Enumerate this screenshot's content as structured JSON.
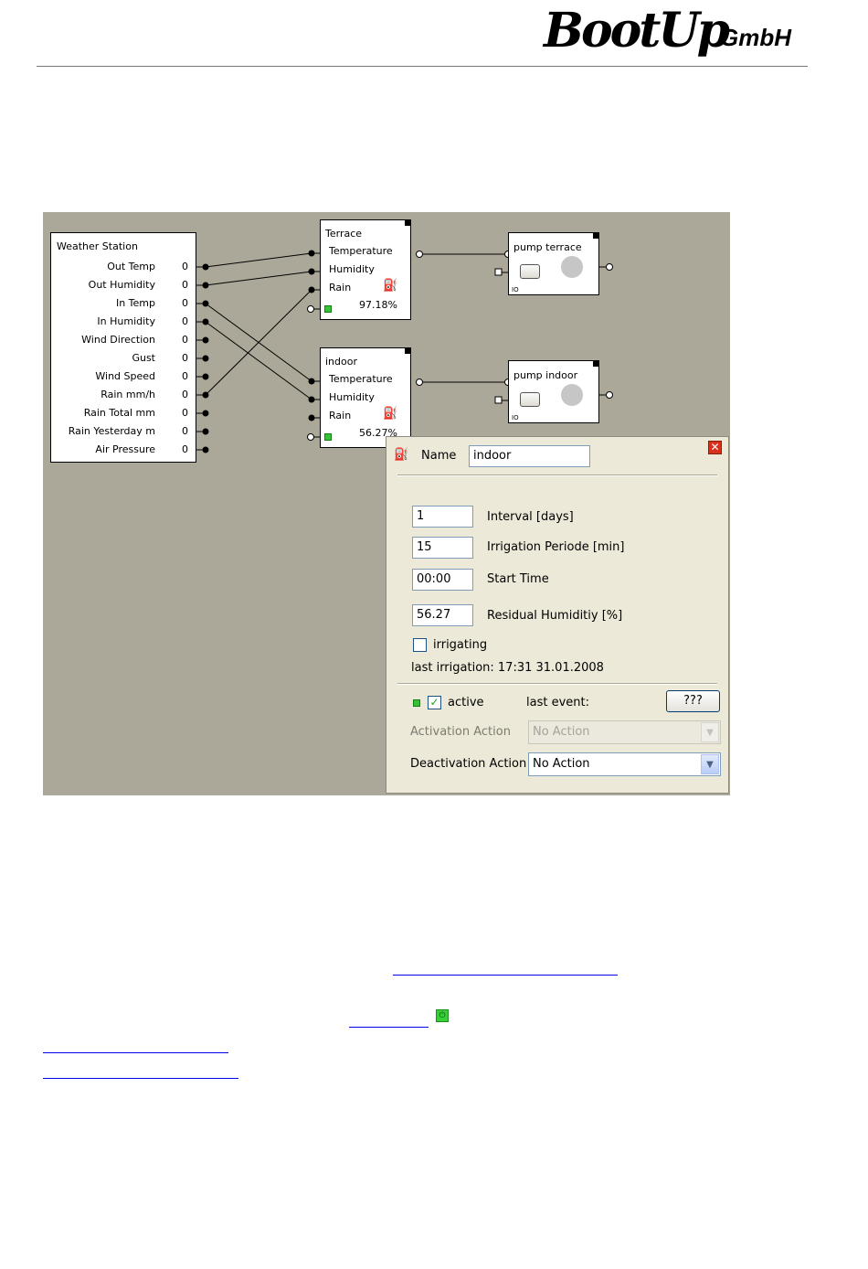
{
  "header": {
    "logo_main": "BootUp",
    "logo_suffix": "GmbH"
  },
  "weather_station": {
    "title": "Weather Station",
    "outputs": [
      {
        "label": "Out Temp",
        "value": "0"
      },
      {
        "label": "Out Humidity",
        "value": "0"
      },
      {
        "label": "In Temp",
        "value": "0"
      },
      {
        "label": "In Humidity",
        "value": "0"
      },
      {
        "label": "Wind Direction",
        "value": "0"
      },
      {
        "label": "Gust",
        "value": "0"
      },
      {
        "label": "Wind Speed",
        "value": "0"
      },
      {
        "label": "Rain mm/h",
        "value": "0"
      },
      {
        "label": "Rain Total mm",
        "value": "0"
      },
      {
        "label": "Rain Yesterday m",
        "value": "0"
      },
      {
        "label": "Air Pressure",
        "value": "0"
      }
    ]
  },
  "irrigation_blocks": [
    {
      "title": "Terrace",
      "inputs": [
        "Temperature",
        "Humidity",
        "Rain"
      ],
      "residual": "97.18%"
    },
    {
      "title": "indoor",
      "inputs": [
        "Temperature",
        "Humidity",
        "Rain"
      ],
      "residual": "56.27%"
    }
  ],
  "pumps": [
    {
      "title": "pump terrace",
      "io": "IO"
    },
    {
      "title": "pump indoor",
      "io": "IO"
    }
  ],
  "dialog": {
    "name_label": "Name",
    "name_value": "indoor",
    "close_glyph": "✕",
    "fields": [
      {
        "value": "1",
        "label": "Interval [days]"
      },
      {
        "value": "15",
        "label": "Irrigation Periode [min]"
      },
      {
        "value": "00:00",
        "label": "Start Time"
      },
      {
        "value": "56.27",
        "label": "Residual Humiditiy [%]"
      }
    ],
    "irrigating_label": "irrigating",
    "last_irrigation": "last irrigation: 17:31  31.01.2008",
    "active_label": "active",
    "last_event_label": "last event:",
    "help_button": "???",
    "activation_label": "Activation Action",
    "activation_value": "No Action",
    "deactivation_label": "Deactivation Action",
    "deactivation_value": "No Action"
  },
  "colors": {
    "canvas": "#aca899",
    "dialog": "#ece9d8",
    "ok_green": "#35c335",
    "link": "#0000ee"
  }
}
